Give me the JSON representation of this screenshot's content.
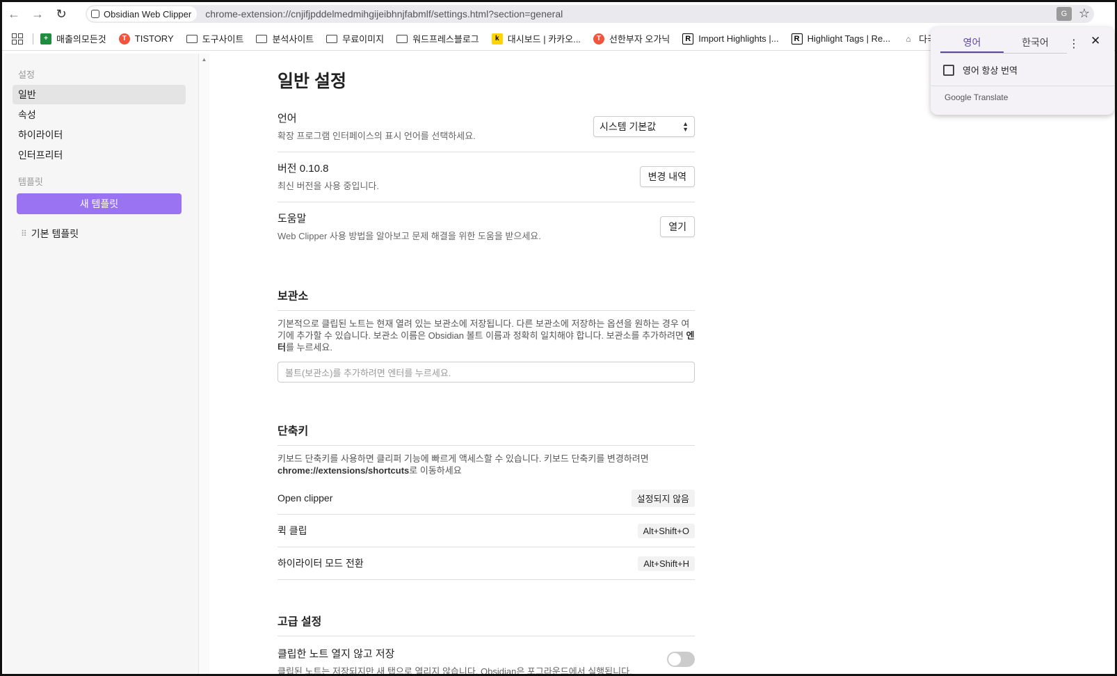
{
  "browser": {
    "tab_title": "Obsidian Web Clipper",
    "url": "chrome-extension://cnjifjpddelmedmihgijeibhnjfabmlf/settings.html?section=general"
  },
  "bookmarks": [
    {
      "label": "매출의모든것",
      "icon": "sheet"
    },
    {
      "label": "TISTORY",
      "icon": "tistory"
    },
    {
      "label": "도구사이트",
      "icon": "folder"
    },
    {
      "label": "분석사이트",
      "icon": "folder"
    },
    {
      "label": "무료이미지",
      "icon": "folder"
    },
    {
      "label": "워드프레스블로그",
      "icon": "folder"
    },
    {
      "label": "대시보드 | 카카오...",
      "icon": "k"
    },
    {
      "label": "선한부자 오가닉",
      "icon": "tistory"
    },
    {
      "label": "Import Highlights |...",
      "icon": "r"
    },
    {
      "label": "Highlight Tags | Re...",
      "icon": "r"
    },
    {
      "label": "다국",
      "icon": "misc"
    }
  ],
  "sidebar": {
    "settings_heading": "설정",
    "items": [
      {
        "label": "일반",
        "active": true
      },
      {
        "label": "속성",
        "active": false
      },
      {
        "label": "하이라이터",
        "active": false
      },
      {
        "label": "인터프리터",
        "active": false
      }
    ],
    "templates_heading": "템플릿",
    "new_template": "새 템플릿",
    "template_items": [
      "기본 템플릿"
    ]
  },
  "main": {
    "title": "일반 설정",
    "language": {
      "title": "언어",
      "desc": "확장 프로그램 인터페이스의 표시 언어를 선택하세요.",
      "value": "시스템 기본값"
    },
    "version": {
      "title": "버전 0.10.8",
      "desc": "최신 버전을 사용 중입니다.",
      "button": "변경 내역"
    },
    "help": {
      "title": "도움말",
      "desc": "Web Clipper 사용 방법을 알아보고 문제 해결을 위한 도움을 받으세요.",
      "button": "열기"
    },
    "vault": {
      "title": "보관소",
      "desc_pre": "기본적으로 클립된 노트는 현재 열려 있는 보관소에 저장됩니다. 다른 보관소에 저장하는 옵션을 원하는 경우 여기에 추가할 수 있습니다. 보관소 이름은 Obsidian 볼트 이름과 정확히 일치해야 합니다. 보관소를 추가하려면 ",
      "desc_bold": "엔터",
      "desc_post": "를 누르세요.",
      "placeholder": "볼트(보관소)를 추가하려면 엔터를 누르세요."
    },
    "shortcuts": {
      "title": "단축키",
      "desc_pre": "키보드 단축키를 사용하면 클리퍼 기능에 빠르게 액세스할 수 있습니다. 키보드 단축키를 변경하려면 ",
      "desc_bold": "chrome://extensions/shortcuts",
      "desc_post": "로 이동하세요",
      "items": [
        {
          "label": "Open clipper",
          "key": "설정되지 않음"
        },
        {
          "label": "퀵 클립",
          "key": "Alt+Shift+O"
        },
        {
          "label": "하이라이터 모드 전환",
          "key": "Alt+Shift+H"
        }
      ]
    },
    "advanced": {
      "title": "고급 설정",
      "item_title": "클립한 노트 열지 않고 저장",
      "item_desc": "클립된 노트는 저장되지만 새 탭으로 열리지 않습니다. Obsidian은 포그라운드에서 실행됩니다.",
      "toggle_on": false
    }
  },
  "translate_popup": {
    "tab_source": "영어",
    "tab_target": "한국어",
    "always_translate": "영어 항상 번역",
    "brand": "Google Translate"
  }
}
